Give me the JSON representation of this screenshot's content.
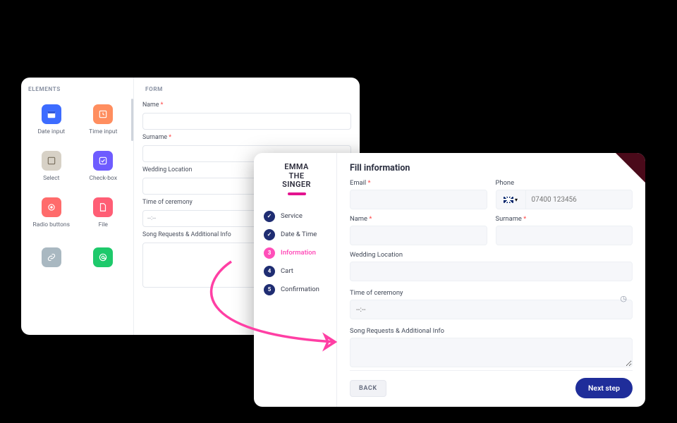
{
  "builder": {
    "elements_header": "ELEMENTS",
    "form_header": "FORM",
    "elements": [
      {
        "label": "Date input",
        "icon": "calendar-icon",
        "tone": "i-blue"
      },
      {
        "label": "Time input",
        "icon": "clock-box-icon",
        "tone": "i-orange"
      },
      {
        "label": "Select",
        "icon": "select-icon",
        "tone": "i-beige"
      },
      {
        "label": "Check-box",
        "icon": "checkbox-icon",
        "tone": "i-purple"
      },
      {
        "label": "Radio buttons",
        "icon": "radio-icon",
        "tone": "i-coral"
      },
      {
        "label": "File",
        "icon": "file-icon",
        "tone": "i-red"
      },
      {
        "label": "",
        "icon": "link-icon",
        "tone": "i-gray"
      },
      {
        "label": "",
        "icon": "at-icon",
        "tone": "i-green"
      }
    ],
    "fields": {
      "name_label": "Name",
      "surname_label": "Surname",
      "location_label": "Wedding Location",
      "time_label": "Time of ceremony",
      "time_placeholder": "--:--",
      "notes_label": "Song Requests & Additional Info"
    }
  },
  "booking": {
    "brand_line1": "EMMA",
    "brand_line2": "THE",
    "brand_line3": "SINGER",
    "steps": [
      {
        "label": "Service",
        "state": "done",
        "mark": "✓"
      },
      {
        "label": "Date & Time",
        "state": "done",
        "mark": "✓"
      },
      {
        "label": "Information",
        "state": "active",
        "mark": "3"
      },
      {
        "label": "Cart",
        "state": "todo",
        "mark": "4"
      },
      {
        "label": "Confirmation",
        "state": "todo",
        "mark": "5"
      }
    ],
    "title": "Fill information",
    "labels": {
      "email": "Email",
      "phone": "Phone",
      "phone_placeholder": "07400 123456",
      "name": "Name",
      "surname": "Surname",
      "location": "Wedding Location",
      "time": "Time of ceremony",
      "time_placeholder": "--:--",
      "notes": "Song Requests & Additional Info"
    },
    "buttons": {
      "back": "BACK",
      "next": "Next step"
    }
  }
}
